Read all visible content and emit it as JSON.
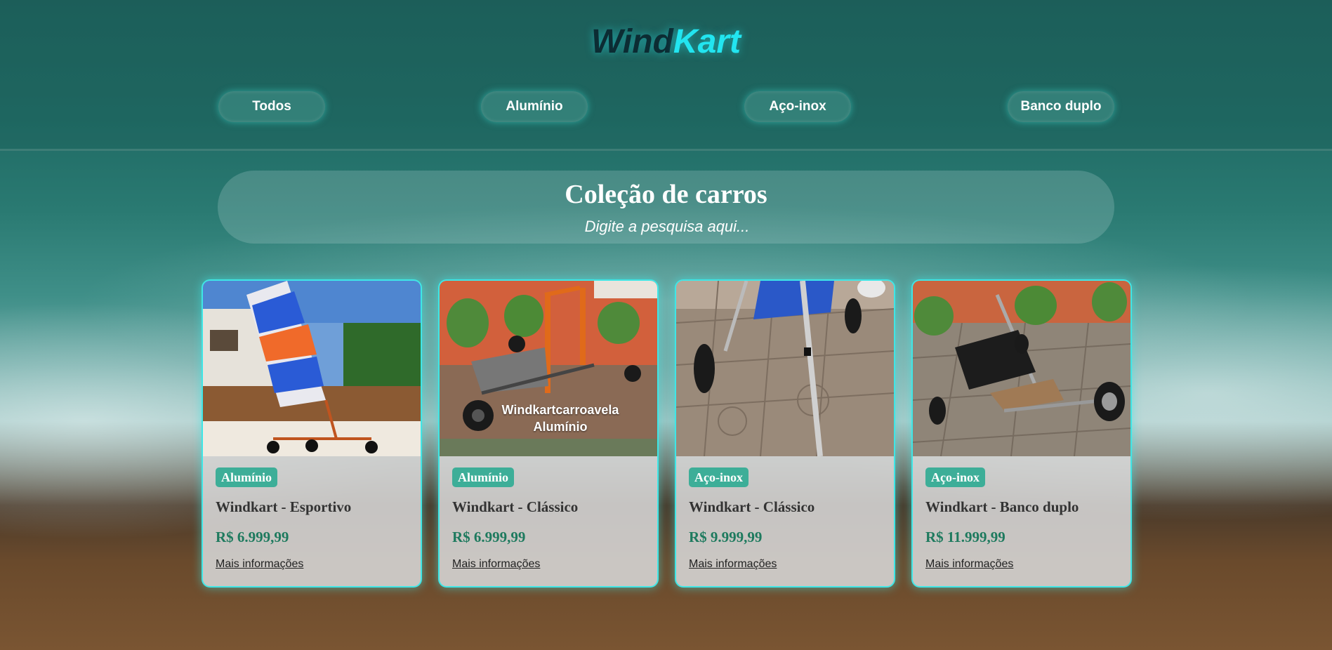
{
  "header": {
    "logo_part1": "Wind",
    "logo_part2": "Kart",
    "nav": [
      "Todos",
      "Alumínio",
      "Aço-inox",
      "Banco duplo"
    ]
  },
  "search": {
    "title": "Coleção de carros",
    "placeholder": "Digite a pesquisa aqui..."
  },
  "products": [
    {
      "category": "Alumínio",
      "name": "Windkart - Esportivo",
      "price": "R$ 6.999,99",
      "link": "Mais informações",
      "image_caption": ""
    },
    {
      "category": "Alumínio",
      "name": "Windkart - Clássico",
      "price": "R$ 6.999,99",
      "link": "Mais informações",
      "image_caption": "Windkartcarroavela Alumínio"
    },
    {
      "category": "Aço-inox",
      "name": "Windkart - Clássico",
      "price": "R$ 9.999,99",
      "link": "Mais informações",
      "image_caption": ""
    },
    {
      "category": "Aço-inox",
      "name": "Windkart - Banco duplo",
      "price": "R$ 11.999,99",
      "link": "Mais informações",
      "image_caption": ""
    }
  ],
  "colors": {
    "accent_cyan": "#22e5f0",
    "badge_green": "#3dae98",
    "price_green": "#1e7a5e",
    "card_border": "#3fe6e6"
  }
}
